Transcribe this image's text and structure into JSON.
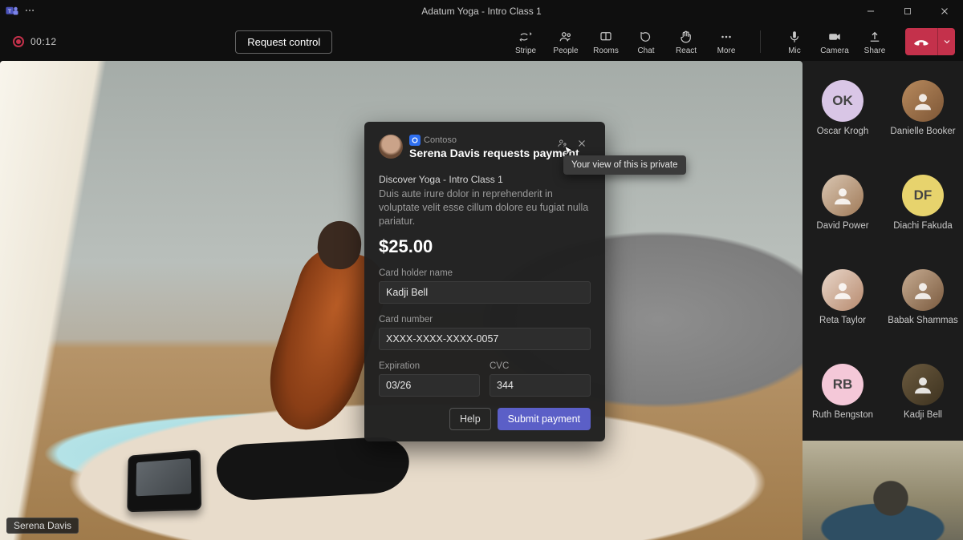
{
  "window": {
    "title": "Adatum Yoga - Intro Class 1"
  },
  "meeting": {
    "recording_time": "00:12",
    "request_control_label": "Request control",
    "presenter_name": "Serena Davis"
  },
  "toolbar": {
    "stripe": "Stripe",
    "people": "People",
    "rooms": "Rooms",
    "chat": "Chat",
    "react": "React",
    "more": "More",
    "mic": "Mic",
    "camera": "Camera",
    "share": "Share"
  },
  "participants": [
    {
      "name": "Oscar Krogh",
      "initials": "OK",
      "bg": "#d9c6e6",
      "photo": false
    },
    {
      "name": "Danielle Booker",
      "initials": "",
      "bg": "linear-gradient(135deg,#b88a5d,#7d5636)",
      "photo": true
    },
    {
      "name": "David Power",
      "initials": "",
      "bg": "linear-gradient(135deg,#d9c6b2,#a07a58)",
      "photo": true
    },
    {
      "name": "Diachi Fakuda",
      "initials": "DF",
      "bg": "#e7d36d",
      "photo": false
    },
    {
      "name": "Reta Taylor",
      "initials": "",
      "bg": "linear-gradient(135deg,#e9d7ca,#b78a6e)",
      "photo": true
    },
    {
      "name": "Babak Shammas",
      "initials": "",
      "bg": "linear-gradient(135deg,#c7ac92,#7a5a3e)",
      "photo": true
    },
    {
      "name": "Ruth Bengston",
      "initials": "RB",
      "bg": "#f4c8d8",
      "photo": false
    },
    {
      "name": "Kadji Bell",
      "initials": "",
      "bg": "linear-gradient(135deg,#6b5a3f,#3d321f)",
      "photo": true
    }
  ],
  "modal": {
    "org": "Contoso",
    "title": "Serena Davis requests payment",
    "tooltip": "Your view of this is private",
    "item_name": "Discover Yoga - Intro Class 1",
    "item_desc": "Duis aute irure dolor in reprehenderit in voluptate velit esse cillum dolore eu fugiat nulla pariatur.",
    "price": "$25.00",
    "labels": {
      "holder": "Card holder name",
      "number": "Card number",
      "exp": "Expiration",
      "cvc": "CVC"
    },
    "values": {
      "holder": "Kadji Bell",
      "number": "XXXX-XXXX-XXXX-0057",
      "exp": "03/26",
      "cvc": "344"
    },
    "help_label": "Help",
    "submit_label": "Submit payment"
  }
}
